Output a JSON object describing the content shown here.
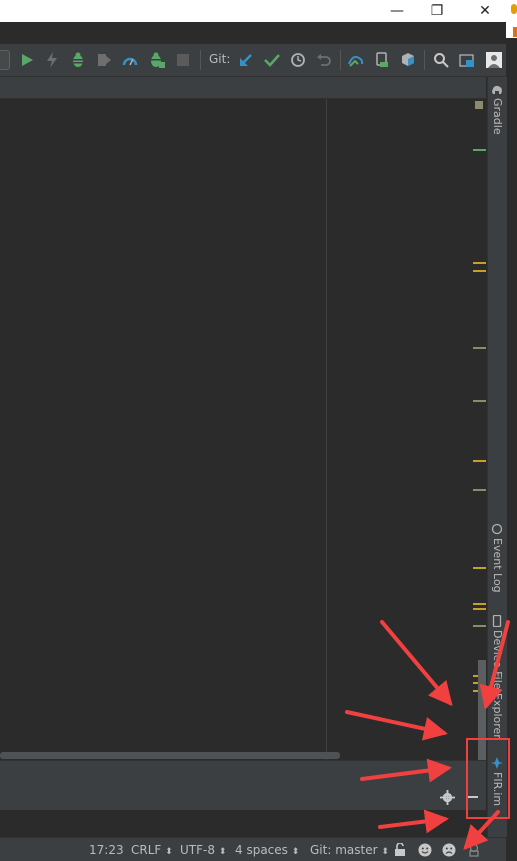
{
  "title_bar": {
    "minimize_glyph": "—",
    "restore_glyph": "❐",
    "close_glyph": "✕"
  },
  "toolbar": {
    "git_label": "Git:",
    "icons": [
      "run-icon",
      "apply-changes-icon",
      "debug-icon",
      "coverage-icon",
      "profile-icon",
      "attach-debugger-icon",
      "stop-icon",
      "git-update-icon",
      "git-commit-icon",
      "git-history-icon",
      "git-revert-icon",
      "gradle-sync-icon",
      "avd-manager-icon",
      "sdk-manager-icon",
      "search-icon",
      "project-structure-icon",
      "account-icon"
    ]
  },
  "right_strip": {
    "gradle_label": "Gradle",
    "event_log_label": "Event Log",
    "device_file_explorer_label": "Device File Explorer",
    "fir_label": "FIR.im"
  },
  "status_bar": {
    "time": "17:23",
    "line_separator": "CRLF",
    "encoding": "UTF-8",
    "indent": "4 spaces",
    "vcs_branch": "Git: master",
    "dropdown_glyph": "⬍"
  },
  "colors": {
    "ide_background": "#2b2b2b",
    "panel": "#3c3f41",
    "annotation_red": "#f04040",
    "run_green": "#59a869",
    "git_blue": "#3592c4",
    "marker_yellow": "#c7a125"
  }
}
